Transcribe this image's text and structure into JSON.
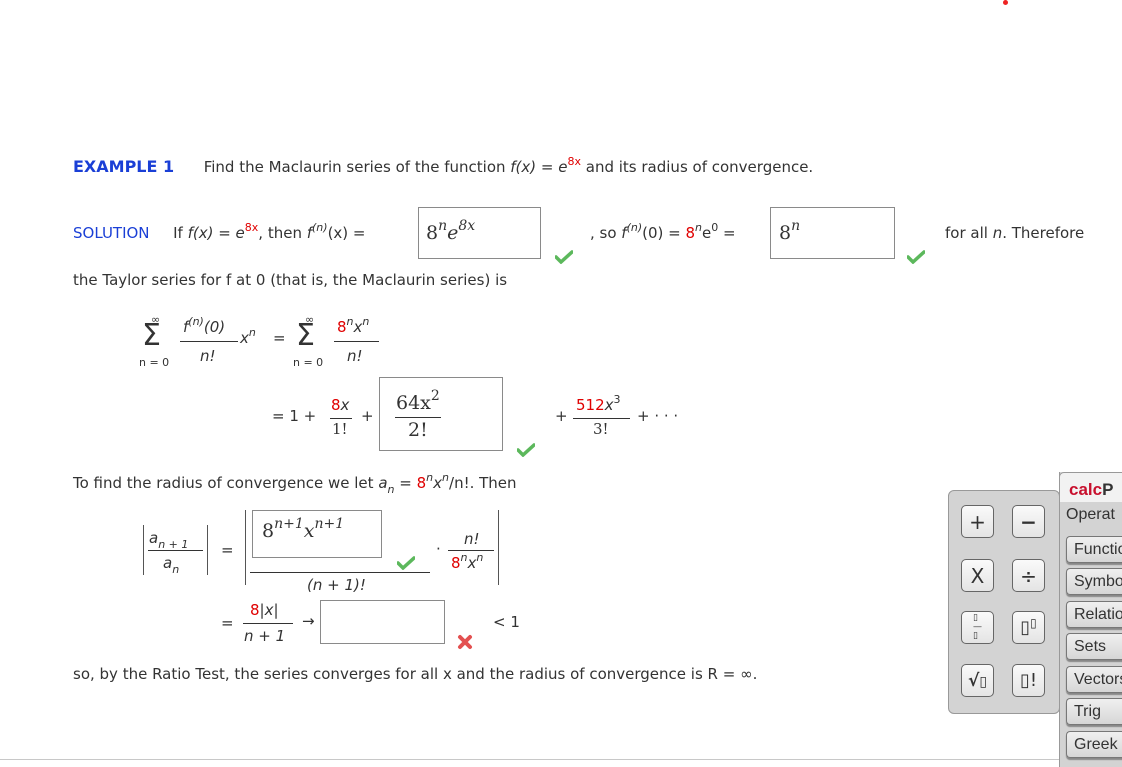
{
  "example": {
    "label": "EXAMPLE 1",
    "text_before": "Find the Maclaurin series of the function ",
    "fx": "f(x) = e",
    "exp": "8x",
    "text_after": " and its radius of convergence."
  },
  "solution": {
    "label": "SOLUTION",
    "if_text": "If ",
    "fx_eq": "f(x) = e",
    "exp": "8x",
    "then_text": ", then ",
    "fn_label": "f",
    "fn_sup": "(n)",
    "fn_arg": "(x) =",
    "answer1": {
      "base": "8",
      "sup1": "n",
      "e": "e",
      "sup2": "8x",
      "status": "correct"
    },
    "so_text": ", so ",
    "f0_label": "f",
    "f0_sup": "(n)",
    "f0_arg": "(0) = ",
    "eight": "8",
    "n_sup": "n",
    "e0": "e",
    "zero_sup": "0",
    "eq": " =",
    "answer2": {
      "base": "8",
      "sup": "n",
      "status": "correct"
    },
    "for_all": "for all ",
    "n": "n",
    "therefore": ". Therefore"
  },
  "taylor_line": "the Taylor series for f at 0 (that is, the Maclaurin series) is",
  "series": {
    "sigma": "Σ",
    "inf": "∞",
    "lower": "n = 0",
    "num1": "f(n)(0)",
    "den1": "n!",
    "xn": "x",
    "n": "n",
    "eq": "=",
    "num2_red": "8",
    "num2_rest": "x",
    "den2": "n!",
    "expansion": {
      "eq_one_plus": "= 1 +",
      "t1_num_red": "8",
      "t1_num": "x",
      "t1_den": "1!",
      "plus": "+",
      "answer3": {
        "num": "64x",
        "num_sup": "2",
        "den": "2!",
        "status": "correct"
      },
      "t3_num_red": "512",
      "t3_num": "x",
      "t3_sup": "3",
      "t3_den": "3!",
      "tail": "+  · · ·"
    }
  },
  "radius_line": {
    "text": "To find the radius of convergence we let ",
    "a": "a",
    "n": "n",
    "eq": " = ",
    "red8": "8",
    "rest": "x",
    "over": "/n!. Then"
  },
  "ratio": {
    "lhs_num": "a",
    "lhs_num_sub": "n + 1",
    "lhs_den": "a",
    "lhs_den_sub": "n",
    "eq": "=",
    "answer4": {
      "base": "8",
      "sup1": "n+1",
      "x": "x",
      "sup2": "n+1",
      "status": "correct"
    },
    "den": "(n + 1)!",
    "dot": "·",
    "right_num": "n!",
    "right_den_red": "8",
    "right_den": "x"
  },
  "limit": {
    "eq": "=",
    "num_red": "8",
    "num": "|x|",
    "den": "n + 1",
    "arrow": "→",
    "answer5": {
      "value": "",
      "status": "incorrect"
    },
    "lt": "< 1"
  },
  "conclusion": "so, by the Ratio Test, the series converges for all x and the radius of convergence is R = ∞.",
  "palette": {
    "buttons": [
      "+",
      "−",
      "X",
      "÷",
      "fraction",
      "superscript",
      "sqrt",
      "factorial"
    ],
    "brand_red": "calc",
    "brand_rest": "P",
    "operations": "Operat",
    "tabs": [
      "Functio",
      "Symbo",
      "Relatio",
      "Sets",
      "Vectors",
      "Trig",
      "Greek"
    ]
  }
}
